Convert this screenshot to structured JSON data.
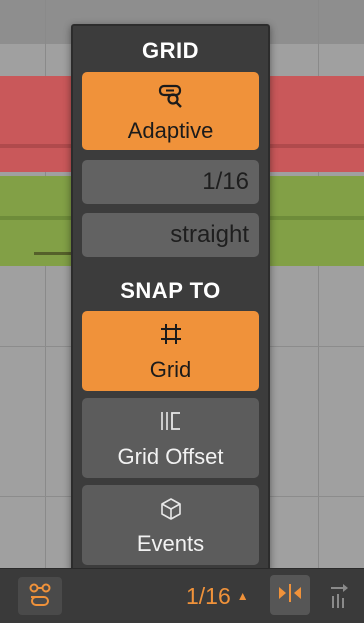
{
  "popup": {
    "grid_title": "GRID",
    "adaptive_label": "Adaptive",
    "grid_value": "1/16",
    "grid_mode": "straight",
    "snap_title": "SNAP TO",
    "snap_grid_label": "Grid",
    "snap_grid_offset_label": "Grid Offset",
    "snap_events_label": "Events"
  },
  "statusbar": {
    "grid_readout": "1/16",
    "grid_readout_caret": "▲"
  },
  "colors": {
    "accent": "#f0923a",
    "popup_bg": "#3c3c3c",
    "button_grey": "#5c5c5c"
  }
}
